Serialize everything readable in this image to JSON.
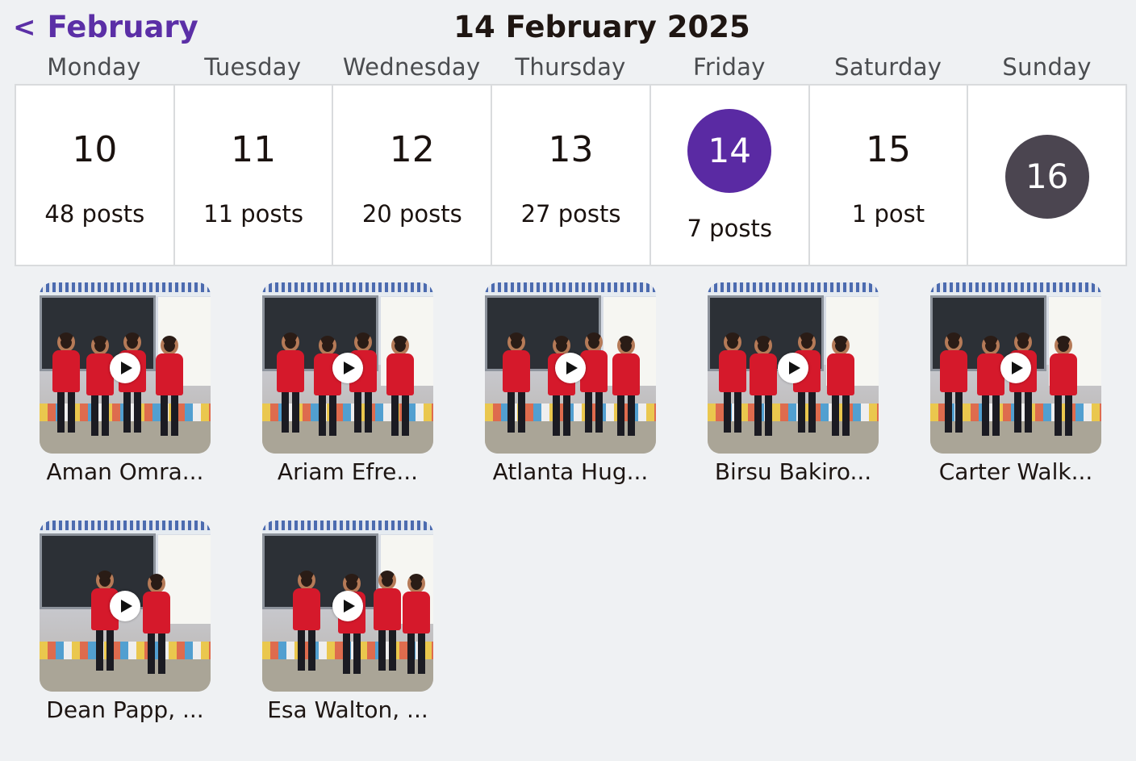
{
  "header": {
    "back_chevron": "<",
    "back_label": "February",
    "title": "14 February 2025"
  },
  "weekdays": [
    "Monday",
    "Tuesday",
    "Wednesday",
    "Thursday",
    "Friday",
    "Saturday",
    "Sunday"
  ],
  "days": [
    {
      "num": "10",
      "posts": "48 posts"
    },
    {
      "num": "11",
      "posts": "11 posts"
    },
    {
      "num": "12",
      "posts": "20 posts"
    },
    {
      "num": "13",
      "posts": "27 posts"
    },
    {
      "num": "14",
      "posts": "7 posts",
      "state": "selected"
    },
    {
      "num": "15",
      "posts": "1 post"
    },
    {
      "num": "16",
      "posts": "",
      "state": "today"
    }
  ],
  "colors": {
    "accent": "#5a2aa3",
    "today": "#4b4550",
    "background": "#eff1f3"
  },
  "posts": [
    {
      "caption": "Aman Omra...",
      "icon": "play-icon"
    },
    {
      "caption": "Ariam Efre...",
      "icon": "play-icon"
    },
    {
      "caption": "Atlanta Hug...",
      "icon": "play-icon"
    },
    {
      "caption": "Birsu Bakiro...",
      "icon": "play-icon"
    },
    {
      "caption": "Carter Walk...",
      "icon": "play-icon"
    },
    {
      "caption": "Dean Papp, ...",
      "icon": "play-icon"
    },
    {
      "caption": "Esa Walton, ...",
      "icon": "play-icon"
    }
  ]
}
